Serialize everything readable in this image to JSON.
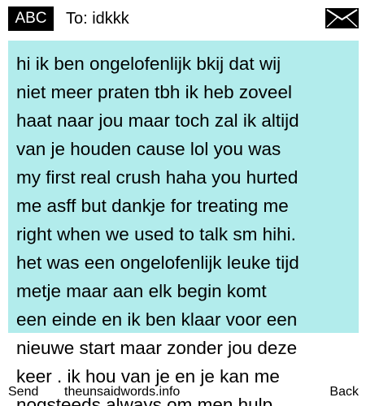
{
  "header": {
    "input_mode": "ABC",
    "to_line": "To: idkkk",
    "icon": "envelope-icon"
  },
  "message": {
    "text": "hi ik ben ongelofenlijk bkij dat wij\nniet meer praten tbh ik heb zoveel\nhaat naar jou maar toch zal ik altijd\nvan je houden cause lol you was\nmy first real crush haha you hurted\nme asff but dankje for treating me\nright when we used to talk sm hihi.\nhet was een ongelofenlijk leuke tijd\nmetje maar aan elk begin komt\neen einde en ik ben klaar voor een\nnieuwe start maar zonder jou deze\nkeer . ik hou van je en je kan me\nnogsteeds always om men hulp"
  },
  "softkeys": {
    "left": "Send",
    "center": "theunsaidwords.info",
    "right": "Back"
  },
  "colors": {
    "highlight": "#b2ecec",
    "badge_bg": "#000000",
    "text": "#000000"
  }
}
